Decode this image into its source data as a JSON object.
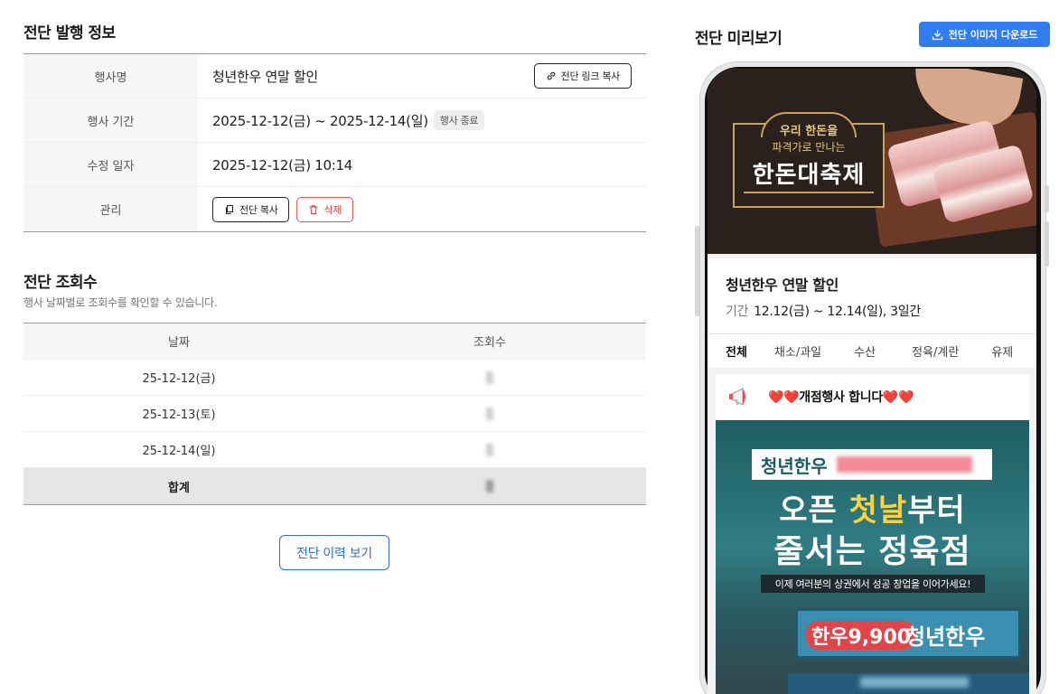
{
  "publish_info": {
    "title": "전단 발행 정보",
    "rows": [
      {
        "label": "행사명",
        "value": "청년한우 연말 할인"
      },
      {
        "label": "행사 기간",
        "value": "2025-12-12(금) ~ 2025-12-14(일)"
      },
      {
        "label": "수정 일자",
        "value": "2025-12-12(금) 10:14"
      },
      {
        "label": "관리",
        "value": ""
      }
    ],
    "status_badge": "행사 종료",
    "copy_link_label": "전단 링크 복사",
    "copy_flyer_label": "전단 복사",
    "delete_label": "삭제"
  },
  "views": {
    "title": "전단 조회수",
    "subtitle": "행사 날짜별로 조회수를 확인할 수 있습니다.",
    "headers": [
      "날짜",
      "조회수"
    ],
    "rows": [
      {
        "date": "25-12-12(금)"
      },
      {
        "date": "25-12-13(토)"
      },
      {
        "date": "25-12-14(일)"
      }
    ],
    "total_label": "합계",
    "history_button": "전단 이력 보기"
  },
  "preview": {
    "title": "전단 미리보기",
    "download_label": "전단 이미지 다운로드",
    "banner": {
      "line1": "우리 한돈을",
      "line2": "파격가로 만나는",
      "line3": "한돈대축제"
    },
    "event_title": "청년한우 연말 할인",
    "period_label": "기간",
    "period_value": "12.12(금) ~ 12.14(일), 3일간",
    "tabs": [
      "전체",
      "채소/과일",
      "수산",
      "정육/계란",
      "유제"
    ],
    "notice": "❤️❤️개점행사 합니다❤️❤️",
    "poster": {
      "tag": "청년한우",
      "headline_pre": "오픈 ",
      "headline_hl": "첫날",
      "headline_post": "부터",
      "headline2": "줄서는 정육점",
      "sub": "이제 여러분의 상권에서 성공 창업을 이어가세요!",
      "sign_price": "한우9,900",
      "sign_name": "청년한우"
    }
  },
  "colors": {
    "accent": "#2f7df0",
    "danger": "#d03a3a",
    "history_border": "#2b6fd6"
  }
}
